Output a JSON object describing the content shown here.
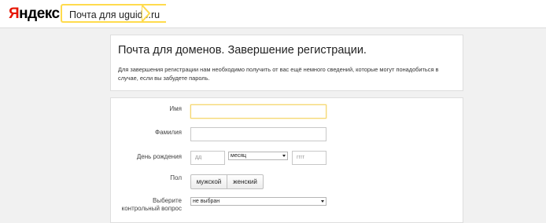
{
  "header": {
    "logo_first": "Я",
    "logo_rest": "ндекс",
    "tag": "Почта для uguide.ru"
  },
  "intro": {
    "title": "Почта для доменов. Завершение регистрации.",
    "description": "Для завершения регистрации нам необходимо получить от вас ещё немного сведений, которые могут понадобиться в случае, если вы забудете пароль."
  },
  "form": {
    "first_name": {
      "label": "Имя",
      "value": ""
    },
    "last_name": {
      "label": "Фамилия",
      "value": ""
    },
    "birthday": {
      "label": "День рождения",
      "day_placeholder": "дд",
      "month_selected": "месяц",
      "year_placeholder": "гггг"
    },
    "gender": {
      "label": "Пол",
      "options": [
        "мужской",
        "женский"
      ]
    },
    "security_question": {
      "label_line1": "Выберите",
      "label_line2": "контрольный вопрос",
      "selected": "не выбран"
    }
  },
  "colors": {
    "page_bg": "#f1f1f1",
    "logo_red": "#e61400",
    "tag_border": "#ffdb4d",
    "focus_border": "#f3d56c"
  }
}
